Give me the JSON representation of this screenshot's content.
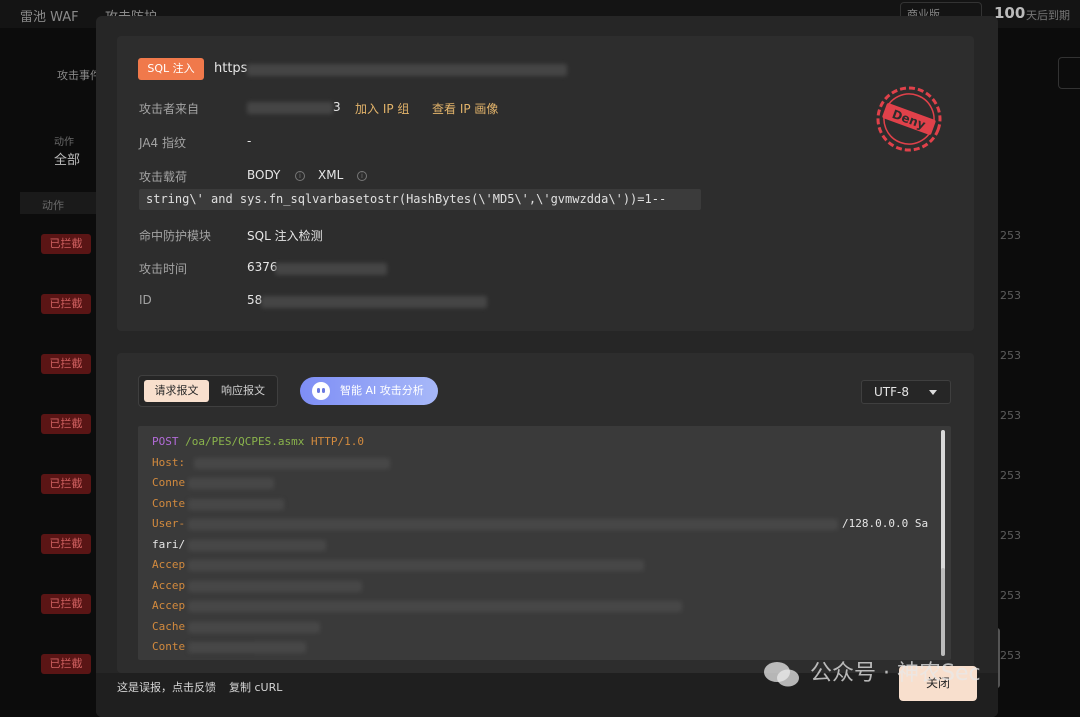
{
  "background": {
    "breadcrumb": [
      "雷池 WAF",
      ">",
      "攻击防护"
    ],
    "edition_label": "商业版",
    "day_count": "100",
    "day_count_suffix": "天后到期",
    "tab_label": "攻击事件",
    "filter_label": "动作",
    "filter_value": "全部",
    "table_header": "动作",
    "row_badge": "已拦截",
    "row_number": "253"
  },
  "detail": {
    "tag": "SQL 注入",
    "url_prefix": "https",
    "attacker_label": "攻击者来自",
    "attacker_suffix": "3",
    "add_ip_group": "加入 IP 组",
    "view_ip_profile": "查看 IP 画像",
    "ja4_label": "JA4 指纹",
    "ja4_value": "-",
    "payload_label": "攻击载荷",
    "payload_location": "BODY",
    "payload_format": "XML",
    "payload": "string\\' and sys.fn_sqlvarbasetostr(HashBytes(\\'MD5\\',\\'gvmwzdda\\'))=1--",
    "module_label": "命中防护模块",
    "module_value": "SQL 注入检测",
    "time_label": "攻击时间",
    "time_value_prefix": "6376",
    "id_label": "ID",
    "id_value_prefix": "58",
    "stamp_text": "Deny"
  },
  "request": {
    "tab_request": "请求报文",
    "tab_response": "响应报文",
    "ai_button": "智能 AI 攻击分析",
    "encoding": "UTF-8",
    "method": "POST",
    "path": "/oa/PES/QCPES.asmx",
    "protocol": "HTTP/1.0",
    "headers": [
      "Host:",
      "Conne",
      "Conte",
      "User-",
      "Accep",
      "Accep",
      "Accep",
      "Cache",
      "Conte"
    ],
    "ua_tail": "/128.0.0.0 Sa",
    "ua_cont": "fari/"
  },
  "footer": {
    "report_false": "这是误报，点击反馈",
    "copy_curl": "复制 cURL",
    "close": "关闭"
  },
  "watermark": "公众号 · 神农Sec",
  "colors": {
    "accent": "#f0794b",
    "link": "#e2b36a",
    "button": "#f8dfcd",
    "deny": "#e0414a"
  }
}
